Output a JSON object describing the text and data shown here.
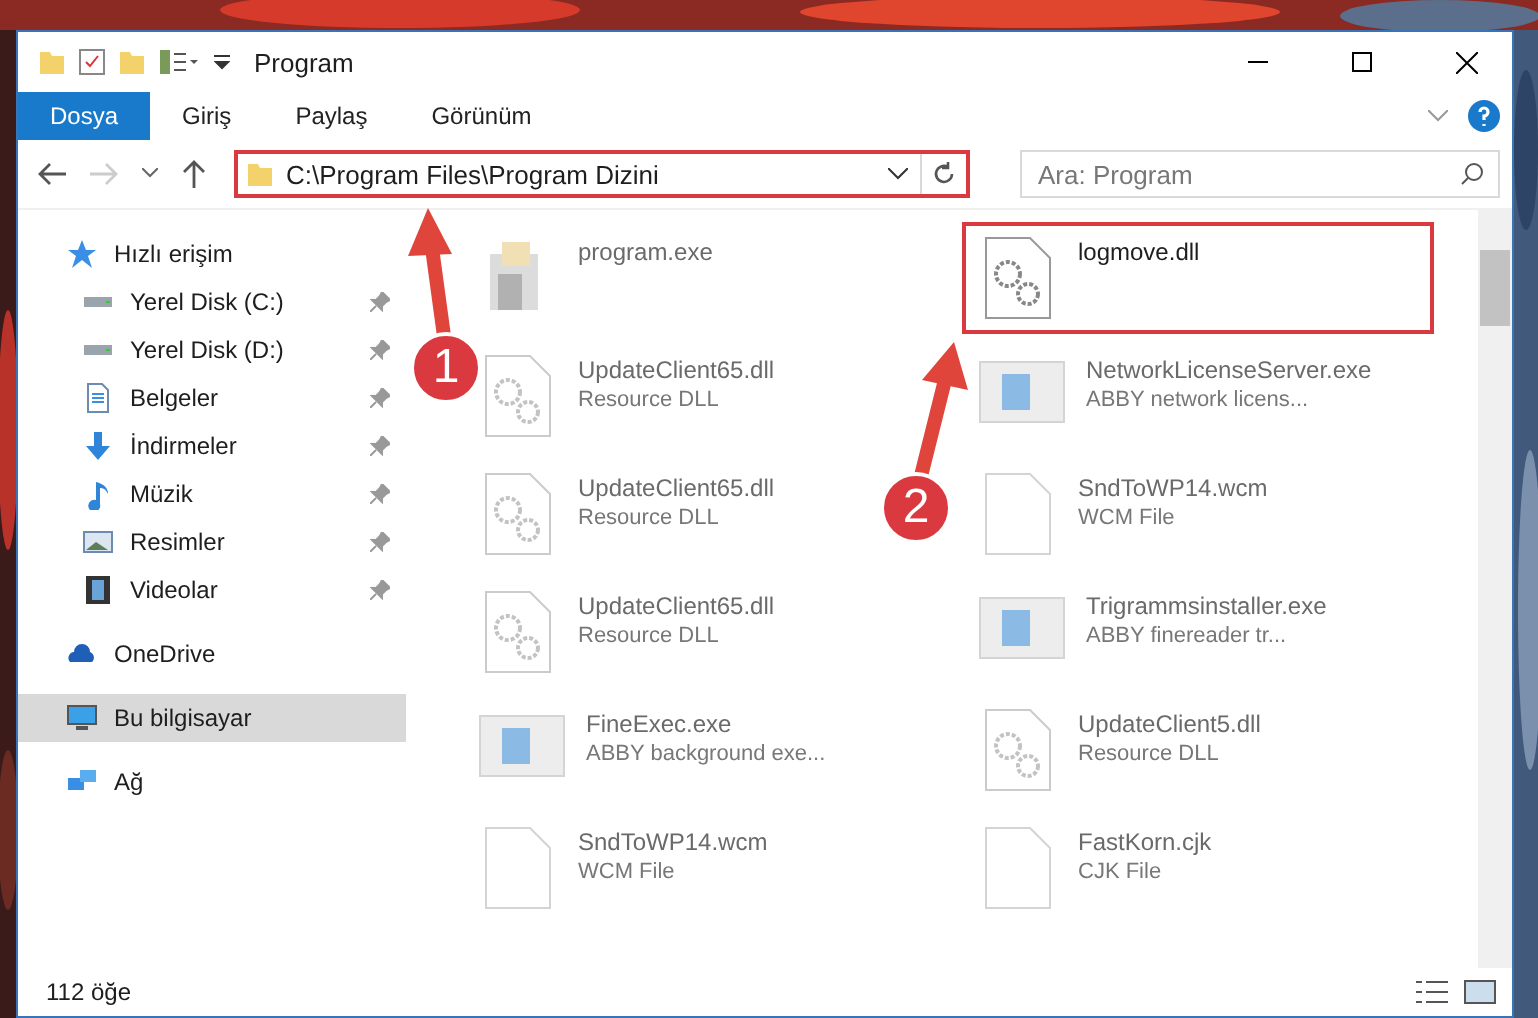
{
  "window": {
    "title": "Program"
  },
  "ribbon_tabs": [
    {
      "label": "Dosya",
      "kind": "file"
    },
    {
      "label": "Giriş",
      "kind": "tab"
    },
    {
      "label": "Paylaş",
      "kind": "tab"
    },
    {
      "label": "Görünüm",
      "kind": "tab"
    }
  ],
  "address": {
    "value": "C:\\Program Files\\Program Dizini",
    "highlighted": true
  },
  "search": {
    "placeholder": "Ara: Program"
  },
  "sidebar": {
    "items": [
      {
        "label": "Hızlı erişim",
        "kind": "star",
        "selected": false,
        "children": [
          {
            "label": "Yerel Disk (C:)",
            "kind": "drive",
            "selected": false
          },
          {
            "label": "Yerel Disk (D:)",
            "kind": "drive",
            "selected": false
          },
          {
            "label": "Belgeler",
            "kind": "docs",
            "selected": false
          },
          {
            "label": "İndirmeler",
            "kind": "download",
            "selected": false
          },
          {
            "label": "Müzik",
            "kind": "music",
            "selected": false
          },
          {
            "label": "Resimler",
            "kind": "pictures",
            "selected": false
          },
          {
            "label": "Videolar",
            "kind": "video",
            "selected": false
          }
        ]
      },
      {
        "label": "OneDrive",
        "kind": "cloud",
        "selected": false
      },
      {
        "label": "Bu bilgisayar",
        "kind": "pc",
        "selected": true
      },
      {
        "label": "Ağ",
        "kind": "network",
        "selected": false
      }
    ]
  },
  "files": [
    {
      "name": "program.exe",
      "kind": "installer",
      "faded": true,
      "highlighted": false
    },
    {
      "name": "logmove.dll",
      "kind": "dll",
      "faded": false,
      "highlighted": true
    },
    {
      "name": "UpdateClient65.dll",
      "type": "Resource DLL",
      "kind": "dll",
      "faded": true,
      "highlighted": false
    },
    {
      "name": "NetworkLicenseServer.exe",
      "type": "ABBY network licens...",
      "kind": "app",
      "faded": true,
      "highlighted": false
    },
    {
      "name": "UpdateClient65.dll",
      "type": "Resource DLL",
      "kind": "dll",
      "faded": true,
      "highlighted": false
    },
    {
      "name": "SndToWP14.wcm",
      "type": "WCM File",
      "kind": "file",
      "faded": true,
      "highlighted": false
    },
    {
      "name": "UpdateClient65.dll",
      "type": "Resource DLL",
      "kind": "dll",
      "faded": true,
      "highlighted": false
    },
    {
      "name": "Trigrammsinstaller.exe",
      "type": "ABBY finereader tr...",
      "kind": "app",
      "faded": true,
      "highlighted": false
    },
    {
      "name": "FineExec.exe",
      "type": "ABBY background exe...",
      "kind": "app",
      "faded": true,
      "highlighted": false
    },
    {
      "name": "UpdateClient5.dll",
      "type": "Resource DLL",
      "kind": "dll",
      "faded": true,
      "highlighted": false
    },
    {
      "name": "SndToWP14.wcm",
      "type": "WCM File",
      "kind": "file",
      "faded": true,
      "highlighted": false
    },
    {
      "name": "FastKorn.cjk",
      "type": "CJK File",
      "kind": "file",
      "faded": true,
      "highlighted": false
    }
  ],
  "status_bar": {
    "count": "112 öğe"
  },
  "callouts": [
    {
      "number": "1"
    },
    {
      "number": "2"
    }
  ]
}
